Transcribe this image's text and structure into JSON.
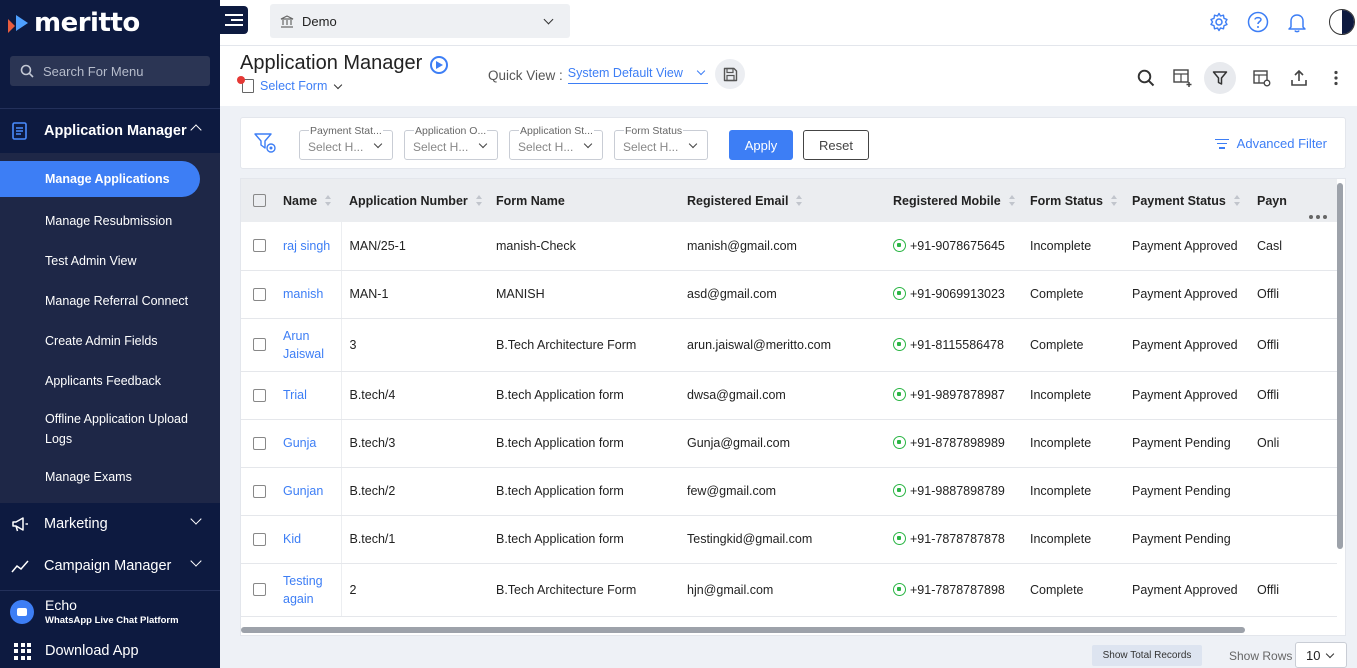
{
  "brand": {
    "logo_text": "meritto"
  },
  "sidebar": {
    "search_placeholder": "Search For Menu",
    "sections": [
      {
        "label": "Application Manager",
        "icon": "document-icon",
        "expanded": true
      },
      {
        "label": "Marketing",
        "icon": "megaphone-icon",
        "expanded": false
      },
      {
        "label": "Campaign Manager",
        "icon": "campaign-icon",
        "expanded": false
      }
    ],
    "sub_items": [
      {
        "label": "Manage Applications",
        "active": true
      },
      {
        "label": "Manage Resubmission"
      },
      {
        "label": "Test Admin View"
      },
      {
        "label": "Manage Referral Connect"
      },
      {
        "label": "Create Admin Fields"
      },
      {
        "label": "Applicants Feedback"
      },
      {
        "label": "Offline Application Upload Logs"
      },
      {
        "label": "Manage Exams"
      }
    ],
    "echo": {
      "title": "Echo",
      "subtitle": "WhatsApp Live Chat Platform"
    },
    "download": "Download App"
  },
  "topbar": {
    "institute": "Demo",
    "icons": [
      "settings-icon",
      "help-icon",
      "bell-icon",
      "avatar"
    ]
  },
  "header": {
    "title": "Application Manager",
    "select_form": "Select Form",
    "quick_view_label": "Quick View :",
    "quick_view_value": "System Default View",
    "action_icons": [
      "search-icon",
      "add-column-icon",
      "filter-icon",
      "table-settings-icon",
      "upload-icon",
      "more-icon"
    ]
  },
  "filters": {
    "items": [
      {
        "label": "Payment Stat...",
        "value": "Select H..."
      },
      {
        "label": "Application O...",
        "value": "Select H..."
      },
      {
        "label": "Application St...",
        "value": "Select H..."
      },
      {
        "label": "Form Status",
        "value": "Select H..."
      }
    ],
    "apply": "Apply",
    "reset": "Reset",
    "advanced": "Advanced Filter"
  },
  "table": {
    "columns": [
      "Name",
      "Application Number",
      "Form Name",
      "Registered Email",
      "Registered Mobile",
      "Form Status",
      "Payment Status",
      "Payn"
    ],
    "rows": [
      {
        "name": "raj singh",
        "app_no": "MAN/25-1",
        "form": "manish-Check",
        "email": "manish@gmail.com",
        "mobile": "+91-9078675645",
        "form_status": "Incomplete",
        "payment_status": "Payment Approved",
        "payment_mode": "Casl"
      },
      {
        "name": "manish",
        "app_no": "MAN-1",
        "form": "MANISH",
        "email": "asd@gmail.com",
        "mobile": "+91-9069913023",
        "form_status": "Complete",
        "payment_status": "Payment Approved",
        "payment_mode": "Offli"
      },
      {
        "name": "Arun Jaiswal",
        "app_no": "3",
        "form": "B.Tech Architecture Form",
        "email": "arun.jaiswal@meritto.com",
        "mobile": "+91-8115586478",
        "form_status": "Complete",
        "payment_status": "Payment Approved",
        "payment_mode": "Offli"
      },
      {
        "name": "Trial",
        "app_no": "B.tech/4",
        "form": "B.tech Application form",
        "email": "dwsa@gmail.com",
        "mobile": "+91-9897878987",
        "form_status": "Incomplete",
        "payment_status": "Payment Approved",
        "payment_mode": "Offli"
      },
      {
        "name": "Gunja",
        "app_no": "B.tech/3",
        "form": "B.tech Application form",
        "email": "Gunja@gmail.com",
        "mobile": "+91-8787898989",
        "form_status": "Incomplete",
        "payment_status": "Payment Pending",
        "payment_mode": "Onli"
      },
      {
        "name": "Gunjan",
        "app_no": "B.tech/2",
        "form": "B.tech Application form",
        "email": "few@gmail.com",
        "mobile": "+91-9887898789",
        "form_status": "Incomplete",
        "payment_status": "Payment Pending",
        "payment_mode": ""
      },
      {
        "name": "Kid",
        "app_no": "B.tech/1",
        "form": "B.tech Application form",
        "email": "Testingkid@gmail.com",
        "mobile": "+91-7878787878",
        "form_status": "Incomplete",
        "payment_status": "Payment Pending",
        "payment_mode": ""
      },
      {
        "name": "Testing again",
        "app_no": "2",
        "form": "B.Tech Architecture Form",
        "email": "hjn@gmail.com",
        "mobile": "+91-7878787898",
        "form_status": "Complete",
        "payment_status": "Payment Approved",
        "payment_mode": "Offli"
      }
    ]
  },
  "footer": {
    "show_total": "Show Total Records",
    "show_rows_label": "Show Rows",
    "rows_value": "10"
  },
  "colors": {
    "accent": "#3d7ef5",
    "sidebar_bg": "#0d1a40",
    "whatsapp": "#2ab544"
  }
}
